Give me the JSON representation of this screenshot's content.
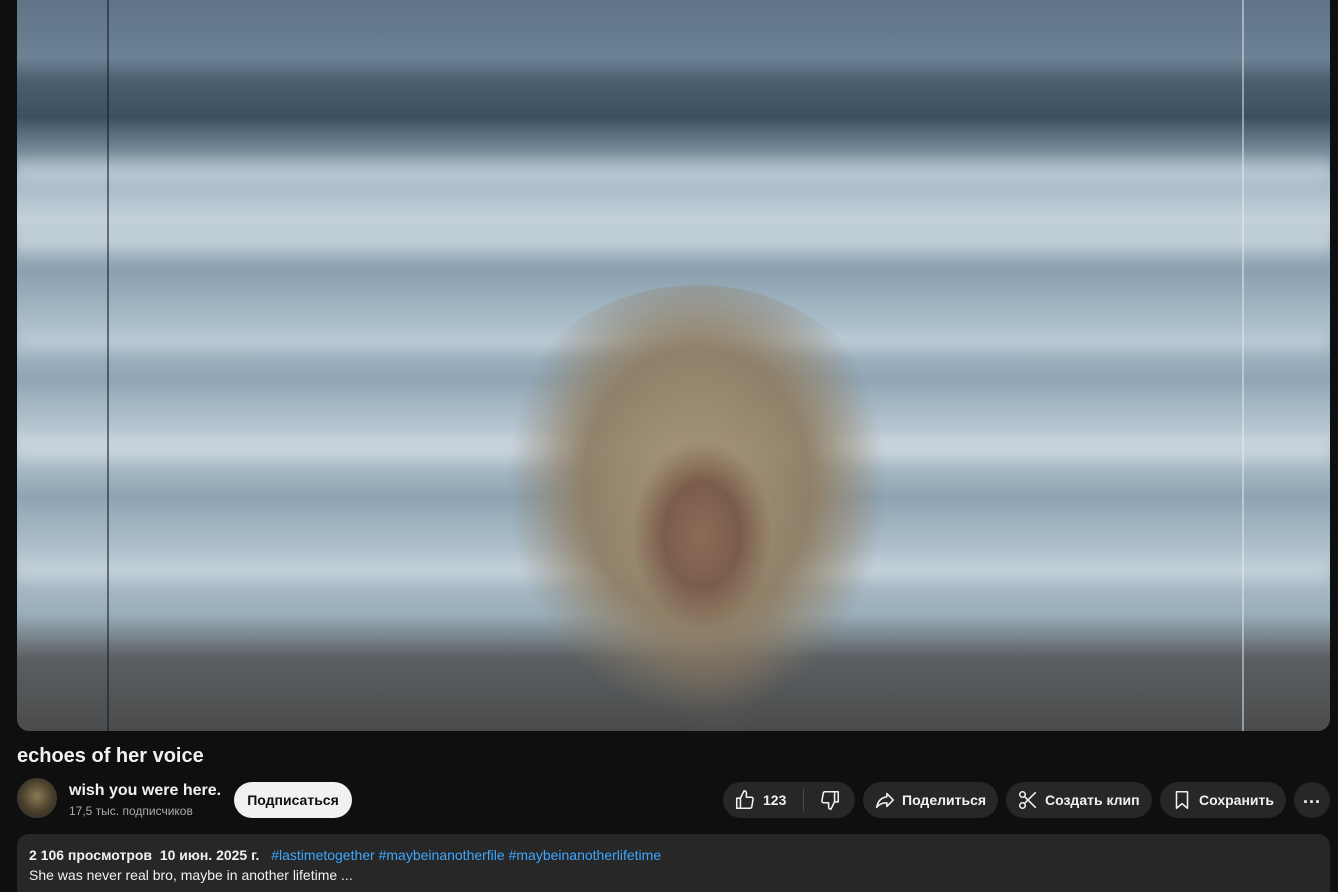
{
  "video": {
    "title": "echoes of her voice"
  },
  "channel": {
    "name": "wish you were here.",
    "subscribers": "17,5 тыс. подписчиков",
    "subscribe_label": "Подписаться"
  },
  "actions": {
    "like_count": "123",
    "share_label": "Поделиться",
    "clip_label": "Создать клип",
    "save_label": "Сохранить",
    "more_label": "..."
  },
  "description": {
    "views": "2 106 просмотров",
    "date": "10 июн. 2025 г.",
    "hashtags": "#lastimetogether #maybeinanotherfile #maybeinanotherlifetime",
    "text": "She was never real bro, maybe in another lifetime ..."
  },
  "icons": {
    "like": "thumbs-up-icon",
    "dislike": "thumbs-down-icon",
    "share": "share-arrow-icon",
    "clip": "scissors-icon",
    "save": "bookmark-icon",
    "more": "more-horizontal-icon"
  },
  "colors": {
    "background": "#0f0f0f",
    "pill": "#272727",
    "link": "#3ea6ff",
    "subscribe_bg": "#f1f1f1"
  }
}
